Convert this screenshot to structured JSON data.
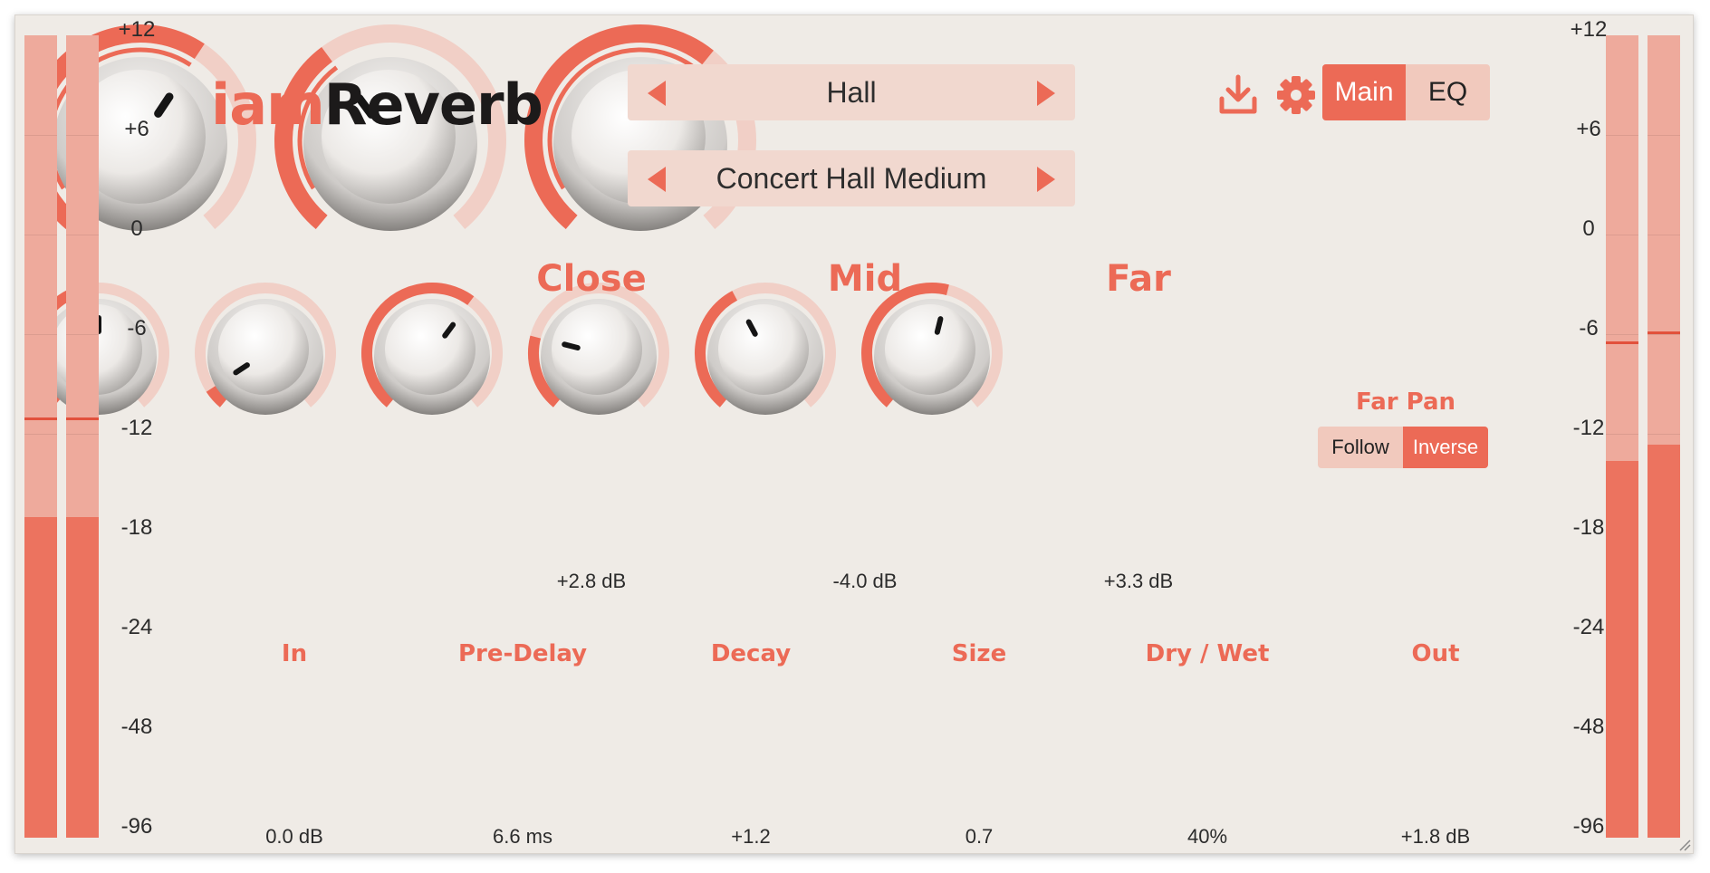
{
  "app": {
    "logo_prefix": "iam",
    "logo_suffix": "Reverb"
  },
  "colors": {
    "accent": "#ec6a56",
    "panel": "#efebe6",
    "meter_track": "#eeaa9c",
    "meter_fill": "#ec735f"
  },
  "presets": {
    "category": "Hall",
    "preset": "Concert Hall Medium"
  },
  "header": {
    "export_icon": "download-icon",
    "settings_icon": "gear-icon",
    "tabs": [
      {
        "label": "Main",
        "active": true
      },
      {
        "label": "EQ",
        "active": false
      }
    ]
  },
  "meter_scale": [
    "+12",
    "+6",
    "0",
    "-6",
    "-12",
    "-18",
    "-24",
    "-48",
    "-96"
  ],
  "meters": {
    "input": [
      {
        "level_fraction": 0.4,
        "peak_fraction": 0.52
      },
      {
        "level_fraction": 0.4,
        "peak_fraction": 0.52
      }
    ],
    "output": [
      {
        "level_fraction": 0.47,
        "peak_fraction": 0.615
      },
      {
        "level_fraction": 0.49,
        "peak_fraction": 0.627
      }
    ]
  },
  "big_knobs": [
    {
      "title": "Close",
      "value": "+2.8 dB",
      "fraction": 0.62
    },
    {
      "title": "Mid",
      "value": "-4.0 dB",
      "fraction": 0.37
    },
    {
      "title": "Far",
      "value": "+3.3 dB",
      "fraction": 0.64
    }
  ],
  "far_pan": {
    "title": "Far Pan",
    "options": [
      {
        "label": "Follow",
        "active": false
      },
      {
        "label": "Inverse",
        "active": true
      }
    ]
  },
  "small_knobs": [
    {
      "title": "In",
      "value": "0.0 dB",
      "fraction": 0.5
    },
    {
      "title": "Pre-Delay",
      "value": "6.6 ms",
      "fraction": 0.06
    },
    {
      "title": "Decay",
      "value": "+1.2",
      "fraction": 0.63
    },
    {
      "title": "Size",
      "value": "0.7",
      "fraction": 0.23
    },
    {
      "title": "Dry / Wet",
      "value": "40%",
      "fraction": 0.4
    },
    {
      "title": "Out",
      "value": "+1.8 dB",
      "fraction": 0.55
    }
  ]
}
